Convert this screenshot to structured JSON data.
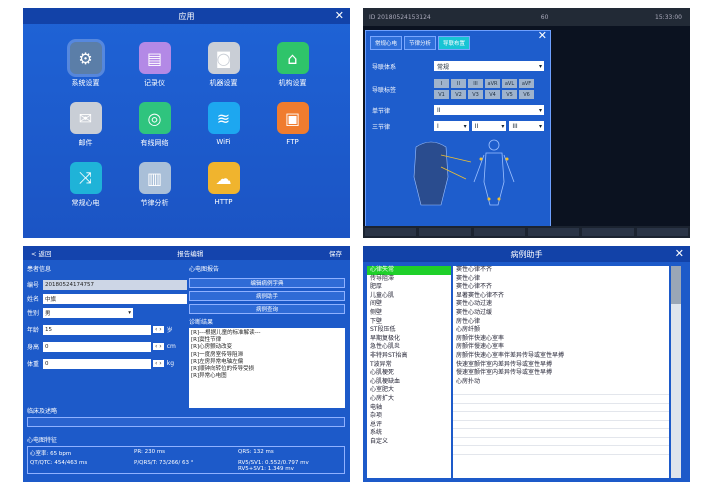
{
  "apps": {
    "title": "应用",
    "items": [
      {
        "label": "系统设置",
        "icon": "gear-icon",
        "color": "#5b7ea8",
        "glyph": "⚙"
      },
      {
        "label": "记录仪",
        "icon": "printer-icon",
        "color": "#b389e6",
        "glyph": "▤"
      },
      {
        "label": "机器设置",
        "icon": "camera-icon",
        "color": "#c9ced6",
        "glyph": "◙"
      },
      {
        "label": "机构设置",
        "icon": "home-icon",
        "color": "#2fc46a",
        "glyph": "⌂"
      },
      {
        "label": "邮件",
        "icon": "mail-icon",
        "color": "#c9ced6",
        "glyph": "✉"
      },
      {
        "label": "有线网络",
        "icon": "network-icon",
        "color": "#2fc47e",
        "glyph": "◎"
      },
      {
        "label": "WiFi",
        "icon": "wifi-icon",
        "color": "#1da7f0",
        "glyph": "≋"
      },
      {
        "label": "FTP",
        "icon": "ftp-icon",
        "color": "#f07c2e",
        "glyph": "▣"
      },
      {
        "label": "常规心电",
        "icon": "shuffle-icon",
        "color": "#1fb3d8",
        "glyph": "⤨"
      },
      {
        "label": "节律分析",
        "icon": "chart-icon",
        "color": "#a9bfd8",
        "glyph": "▥"
      },
      {
        "label": "HTTP",
        "icon": "cloud-icon",
        "color": "#f0b42e",
        "glyph": "☁"
      }
    ]
  },
  "lead": {
    "status": "ID 20180524153124",
    "status2": "60",
    "clock": "15:33:00",
    "tabs": [
      "常规心电",
      "节律分析",
      "导联布置"
    ],
    "system_label": "导联体系",
    "system_value": "常规",
    "label_label": "导联标签",
    "leads": [
      "I",
      "II",
      "III",
      "aVR",
      "aVL",
      "aVF",
      "V1",
      "V2",
      "V3",
      "V4",
      "V5",
      "V6"
    ],
    "single_label": "单节律",
    "single_value": "II",
    "triple_label": "三节律",
    "triple": [
      "I",
      "II",
      "III"
    ]
  },
  "patient": {
    "back": "< 返回",
    "title": "报告编辑",
    "save": "保存",
    "section": "患者信息",
    "id_label": "编号",
    "id_value": "20180524174757",
    "name_label": "姓名",
    "name_value": "中旗",
    "sex_label": "性别",
    "sex_value": "男",
    "age_label": "年龄",
    "age_value": "15",
    "age_unit": "岁",
    "height_label": "身高",
    "height_value": "0",
    "height_unit": "cm",
    "weight_label": "体重",
    "weight_value": "0",
    "weight_unit": "kg",
    "report_title": "心电图报告",
    "btn1": "编辑病例字典",
    "btn2": "病例助手",
    "btn3": "病例查询",
    "diag_title": "诊断结果",
    "diagnoses": [
      "[R]---根据儿童的标准解读---",
      "[R]窦性节律",
      "[R]心房颤动改变",
      "[R]一度房室传导阻滞",
      "[R]左房异常电轴左偏",
      "[R]顺钟向转位的传导受损",
      "[R]异常心电图"
    ],
    "clinic": "临床及述略",
    "ecg": "心电图特征",
    "hr_label": "心室率:",
    "hr_value": "65",
    "hr_unit": "bpm",
    "pr_label": "PR:",
    "pr_value": "230",
    "pr_unit": "ms",
    "qrs_label": "QRS:",
    "qrs_value": "132",
    "qrs_unit": "ms",
    "qt_label": "QT/QTC:",
    "qt_value": "454/463",
    "qt_unit": "ms",
    "axis_label": "P/QRS/T:",
    "axis_value": "73/266/ 63",
    "axis_unit": "°",
    "rv_label": "RV5/SV1:",
    "rv_value": "0.552/0.797",
    "rv_unit": "mv",
    "rvs_label": "RV5+SV1:",
    "rvs_value": "1.349",
    "rvs_unit": "mv"
  },
  "helper": {
    "title": "病例助手",
    "categories": [
      "心律失常",
      "传导阻滞",
      "肥厚",
      "儿童心肌",
      "间壁",
      "侧壁",
      "下壁",
      "ST段压低",
      "早期复极化",
      "急性心肌炎",
      "非特异ST抬高",
      "T波异常",
      "心肌梗死",
      "心肌梗缺血",
      "心室肥大",
      "心房扩大",
      "电轴",
      "杂项",
      "总评",
      "系统",
      "自定义"
    ],
    "items": [
      "窦性心律不齐",
      "窦性心律",
      "窦性心律不齐",
      "显著窦性心律不齐",
      "窦性心动过速",
      "窦性心动过缓",
      "房性心律",
      "心房纤颤",
      "房颤伴快速心室率",
      "房颤伴慢速心室率",
      "房颤伴快速心室率伴差异传导或室性早搏",
      "快速室颤伴室内差异传导或室性早搏",
      "慢速室颤伴室内差异传导或室性早搏",
      "心房扑动"
    ]
  }
}
